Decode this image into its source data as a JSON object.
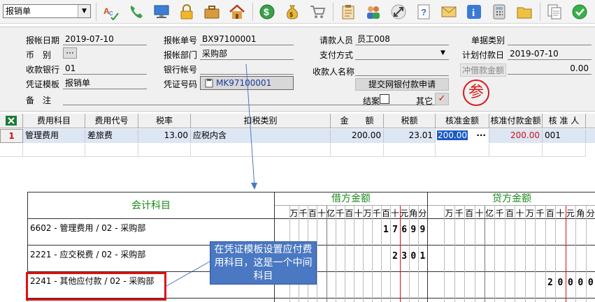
{
  "toolbar": {
    "doctype_select": "报销单"
  },
  "form": {
    "report_date": {
      "label": "报帐日期",
      "value": "2019-07-10"
    },
    "currency": {
      "label": "币　别",
      "value": "···"
    },
    "bank": {
      "label": "收款银行",
      "value": "01"
    },
    "template": {
      "label": "凭证模板",
      "value": "报销单"
    },
    "note": {
      "label": "备　注",
      "value": ""
    },
    "report_no": {
      "label": "报帐单号",
      "value": "BX97100001"
    },
    "dept": {
      "label": "报帐部门",
      "value": "采购部"
    },
    "bank_account": {
      "label": "银行帐号",
      "value": ""
    },
    "voucher_no": {
      "label": "凭证号码",
      "value": "MK97100001"
    },
    "requester": {
      "label": "请款人员",
      "value": "员工008"
    },
    "pay_method": {
      "label": "支付方式",
      "value": ""
    },
    "payee_name": {
      "label": "收款人名称",
      "value": ""
    },
    "submit_button": "提交网银付款申请",
    "settle": {
      "label": "结案",
      "checked": false
    },
    "other": {
      "label": "其它",
      "checked": true
    },
    "doc_category": {
      "label": "单据类别",
      "value": ""
    },
    "plan_pay_date": {
      "label": "计划付款日",
      "value": "2019-07-10"
    },
    "offset_amount": {
      "label": "冲借款金额",
      "value": "0.00"
    },
    "stamp_text": "参"
  },
  "grid": {
    "headers": [
      "费用科目",
      "费用代号",
      "税率",
      "扣税类别",
      "金　　额",
      "税额",
      "核准金额",
      "核准付款金额",
      "核 准 人"
    ],
    "row": {
      "index": "1",
      "expense_subject": "管理费用",
      "expense_code": "差旅费",
      "tax_rate": "13.00",
      "tax_type": "应税内含",
      "amount": "200.00",
      "tax": "23.01",
      "approved_amount": "200.00",
      "approved_pay_amount": "200.00",
      "approver": "001"
    },
    "ellipsis": "···"
  },
  "voucher": {
    "subject_header": "会计科目",
    "debit_header": "借方金额",
    "credit_header": "贷方金额",
    "unit_labels": [
      "万",
      "千",
      "百",
      "十",
      "亿",
      "千",
      "百",
      "十",
      "万",
      "千",
      "百",
      "十",
      "元",
      "角",
      "分"
    ],
    "rows": [
      {
        "subject": "6602 - 管理费用 / 02 - 采购部",
        "debit": "17699",
        "credit": ""
      },
      {
        "subject": "2221 - 应交税费 / 02 - 采购部",
        "debit": "2301",
        "credit": ""
      },
      {
        "subject": "2241 - 其他应付款 / 02 - 采购部",
        "debit": "",
        "credit": "20000"
      }
    ]
  },
  "callout": {
    "text": "在凭证模板设置应付费用科目，这是一个中间科目"
  },
  "colors": {
    "accent_blue": "#4a78c2",
    "red": "#e01010",
    "green_header": "#1a8a1a"
  }
}
